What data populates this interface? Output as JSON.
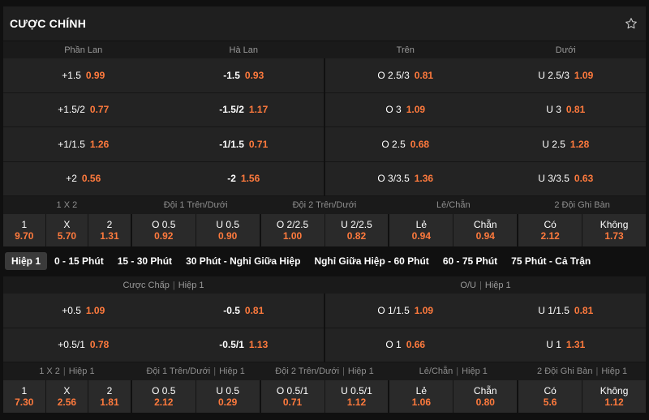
{
  "header": {
    "title": "CƯỢC CHÍNH"
  },
  "main": {
    "headers": [
      "Phần Lan",
      "Hà Lan",
      "Trên",
      "Dưới"
    ],
    "rows": [
      [
        {
          "line": "+1.5",
          "odd": "0.99"
        },
        {
          "line": "-1.5",
          "odd": "0.93"
        },
        {
          "line": "O 2.5/3",
          "odd": "0.81"
        },
        {
          "line": "U 2.5/3",
          "odd": "1.09"
        }
      ],
      [
        {
          "line": "+1.5/2",
          "odd": "0.77"
        },
        {
          "line": "-1.5/2",
          "odd": "1.17"
        },
        {
          "line": "O 3",
          "odd": "1.09"
        },
        {
          "line": "U 3",
          "odd": "0.81"
        }
      ],
      [
        {
          "line": "+1/1.5",
          "odd": "1.26"
        },
        {
          "line": "-1/1.5",
          "odd": "0.71"
        },
        {
          "line": "O 2.5",
          "odd": "0.68"
        },
        {
          "line": "U 2.5",
          "odd": "1.28"
        }
      ],
      [
        {
          "line": "+2",
          "odd": "0.56"
        },
        {
          "line": "-2",
          "odd": "1.56"
        },
        {
          "line": "O 3/3.5",
          "odd": "1.36"
        },
        {
          "line": "U 3/3.5",
          "odd": "0.63"
        }
      ]
    ]
  },
  "markets1": {
    "headers": [
      "1 X 2",
      "Đội 1 Trên/Dưới",
      "Đội 2 Trên/Dưới",
      "Lẻ/Chẵn",
      "2 Đội Ghi Bàn"
    ],
    "groups": [
      [
        {
          "label": "1",
          "value": "9.70"
        },
        {
          "label": "X",
          "value": "5.70"
        },
        {
          "label": "2",
          "value": "1.31"
        }
      ],
      [
        {
          "label": "O 0.5",
          "value": "0.92"
        },
        {
          "label": "U 0.5",
          "value": "0.90"
        }
      ],
      [
        {
          "label": "O 2/2.5",
          "value": "1.00"
        },
        {
          "label": "U 2/2.5",
          "value": "0.82"
        }
      ],
      [
        {
          "label": "Lẻ",
          "value": "0.94"
        },
        {
          "label": "Chẵn",
          "value": "0.94"
        }
      ],
      [
        {
          "label": "Có",
          "value": "2.12"
        },
        {
          "label": "Không",
          "value": "1.73"
        }
      ]
    ]
  },
  "tabs": [
    "Hiệp 1",
    "0 - 15 Phút",
    "15 - 30 Phút",
    "30 Phút - Nghỉ Giữa Hiệp",
    "Nghỉ Giữa Hiệp - 60 Phút",
    "60 - 75 Phút",
    "75 Phút - Cả Trận"
  ],
  "half": {
    "headers": [
      {
        "name": "Cược Chấp",
        "period": "Hiệp 1"
      },
      {
        "name": "O/U",
        "period": "Hiệp 1"
      }
    ],
    "rows": [
      [
        {
          "line": "+0.5",
          "odd": "1.09"
        },
        {
          "line": "-0.5",
          "odd": "0.81"
        },
        {
          "line": "O 1/1.5",
          "odd": "1.09"
        },
        {
          "line": "U 1/1.5",
          "odd": "0.81"
        }
      ],
      [
        {
          "line": "+0.5/1",
          "odd": "0.78"
        },
        {
          "line": "-0.5/1",
          "odd": "1.13"
        },
        {
          "line": "O 1",
          "odd": "0.66"
        },
        {
          "line": "U 1",
          "odd": "1.31"
        }
      ]
    ]
  },
  "markets2": {
    "headers": [
      {
        "name": "1 X 2",
        "period": "Hiệp 1"
      },
      {
        "name": "Đội 1 Trên/Dưới",
        "period": "Hiệp 1"
      },
      {
        "name": "Đội 2 Trên/Dưới",
        "period": "Hiệp 1"
      },
      {
        "name": "Lẻ/Chẵn",
        "period": "Hiệp 1"
      },
      {
        "name": "2 Đội Ghi Bàn",
        "period": "Hiệp 1"
      }
    ],
    "groups": [
      [
        {
          "label": "1",
          "value": "7.30"
        },
        {
          "label": "X",
          "value": "2.56"
        },
        {
          "label": "2",
          "value": "1.81"
        }
      ],
      [
        {
          "label": "O 0.5",
          "value": "2.12"
        },
        {
          "label": "U 0.5",
          "value": "0.29"
        }
      ],
      [
        {
          "label": "O 0.5/1",
          "value": "0.71"
        },
        {
          "label": "U 0.5/1",
          "value": "1.12"
        }
      ],
      [
        {
          "label": "Lẻ",
          "value": "1.06"
        },
        {
          "label": "Chẵn",
          "value": "0.80"
        }
      ],
      [
        {
          "label": "Có",
          "value": "5.6"
        },
        {
          "label": "Không",
          "value": "1.12"
        }
      ]
    ]
  },
  "icons": {
    "favorite": "star-outline-icon"
  },
  "colors": {
    "odd": "#ff7a3d",
    "active_tab": "#3a3a3a"
  }
}
